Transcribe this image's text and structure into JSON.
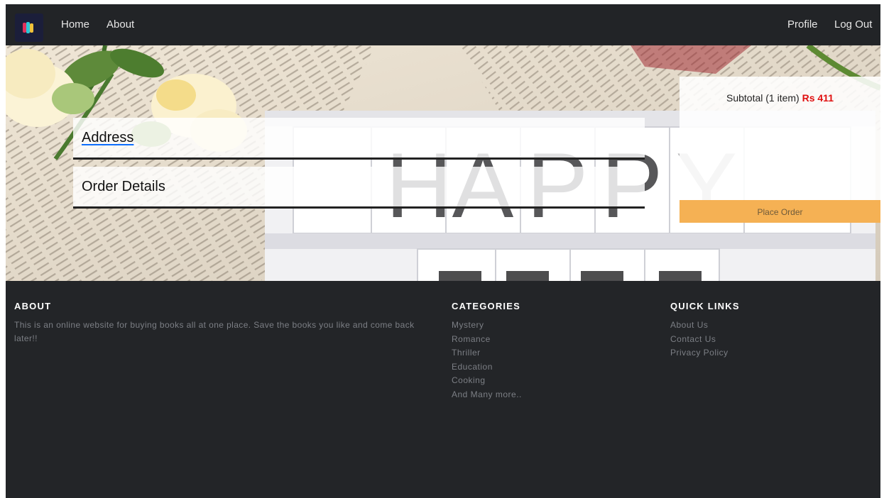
{
  "nav": {
    "logo_icon": "book-stack-logo-icon",
    "left_links": [
      "Home",
      "About"
    ],
    "right_links": [
      "Profile",
      "Log Out"
    ]
  },
  "hero": {
    "background_icon": "happy-days-books-photo",
    "sections": {
      "address_label": "Address",
      "order_details_label": "Order Details"
    },
    "summary": {
      "subtotal_label": "Subtotal (1 item)",
      "subtotal_amount": "Rs 411",
      "place_order_label": "Place Order"
    }
  },
  "footer": {
    "about": {
      "heading": "ABOUT",
      "text": "This is an online website for buying books all at one place. Save the books you like and come back later!!"
    },
    "categories": {
      "heading": "CATEGORIES",
      "items": [
        "Mystery",
        "Romance",
        "Thriller",
        "Education",
        "Cooking",
        "And Many more.."
      ]
    },
    "quick_links": {
      "heading": "QUICK LINKS",
      "items": [
        "About Us",
        "Contact Us",
        "Privacy Policy"
      ]
    }
  },
  "colors": {
    "navbar": "#222427",
    "footer": "#232528",
    "accent_button": "#f5b154",
    "price": "#e01010",
    "footer_text": "#7c7f85"
  }
}
